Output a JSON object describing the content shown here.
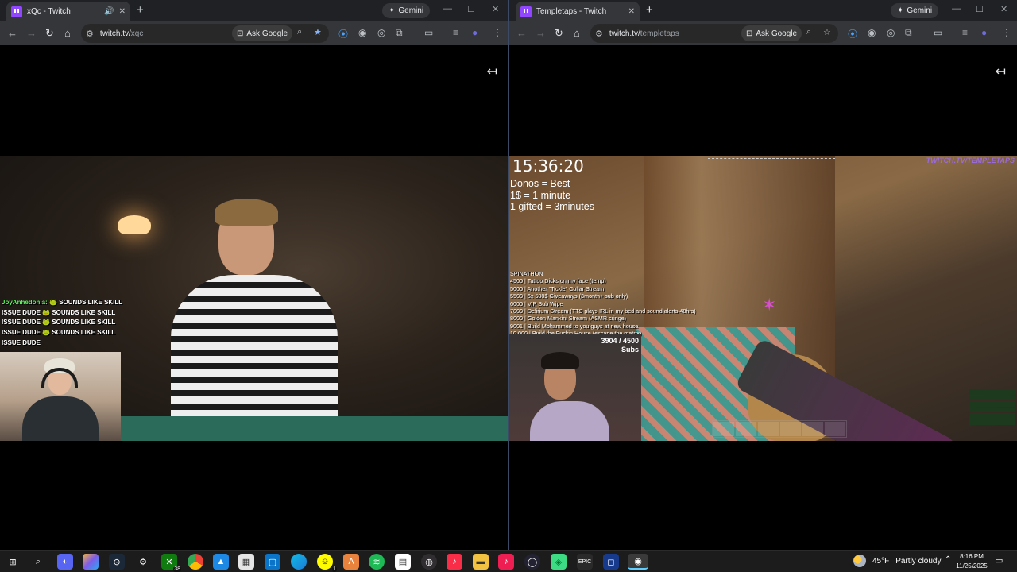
{
  "left_window": {
    "tab_title": "xQc - Twitch",
    "gemini_label": "Gemini",
    "url_host": "twitch.tv/",
    "url_path": "xqc",
    "ask_google_label": "Ask Google",
    "chat": [
      {
        "user": "JoyAnhedonia:",
        "message": "SOUNDS LIKE SKILL"
      },
      {
        "user": "ISSUE DUDE",
        "message": "SOUNDS LIKE SKILL"
      },
      {
        "user": "ISSUE DUDE",
        "message": "SOUNDS LIKE SKILL"
      },
      {
        "user": "ISSUE DUDE",
        "message": "SOUNDS LIKE SKILL"
      },
      {
        "user": "ISSUE DUDE",
        "message": ""
      }
    ]
  },
  "right_window": {
    "tab_title": "Templetaps - Twitch",
    "gemini_label": "Gemini",
    "url_host": "twitch.tv/",
    "url_path": "templetaps",
    "ask_google_label": "Ask Google",
    "overlay": {
      "clock": "15:36:20",
      "rules": [
        "Donos = Best",
        "1$ = 1 minute",
        "1 gifted = 3minutes"
      ],
      "watermark": "TWITCH.TV/TEMPLETAPS",
      "spinathon": [
        "SPINATHON",
        "4500 | Tattoo Dicks on my face (temp)",
        "5000 | Another \"Tickle\" Collar Stream",
        "5500 | 6x 500$ Giveaways (3month+ sub only)",
        "6000 | VIP Sub Wipe",
        "7000 | Delirium Stream (TTS plays IRL in my bed and sound alerts 48hrs)",
        "8000 | Golden Mankini Stream (ASMR cringe)",
        "9001 | Build Mohammed to you guys at new house",
        "10,000 | Build the Fuckin House (escape the matrix)"
      ],
      "sub_goal": "3904 / 4500",
      "sub_goal_unit": "Subs"
    }
  },
  "taskbar": {
    "weather_temp": "45°F",
    "weather_desc": "Partly cloudy",
    "time": "8:16 PM",
    "date": "11/25/2025",
    "badge_xbox": "38",
    "badge_snap": "1",
    "icons": [
      "windows-start",
      "search",
      "discord",
      "copilot",
      "steam",
      "settings",
      "xbox",
      "chrome",
      "bluestacks",
      "store",
      "edge",
      "snapchat",
      "app-a",
      "spotify",
      "notepad",
      "obs",
      "music",
      "folder",
      "tiktok",
      "nox",
      "android-studio",
      "epic-games",
      "virtualbox",
      "chrome-active"
    ]
  },
  "colors": {
    "chrome_dark": "#202124",
    "toolbar": "#35363a",
    "twitch_purple": "#9146ff",
    "taskbar": "#1c1c1c"
  }
}
